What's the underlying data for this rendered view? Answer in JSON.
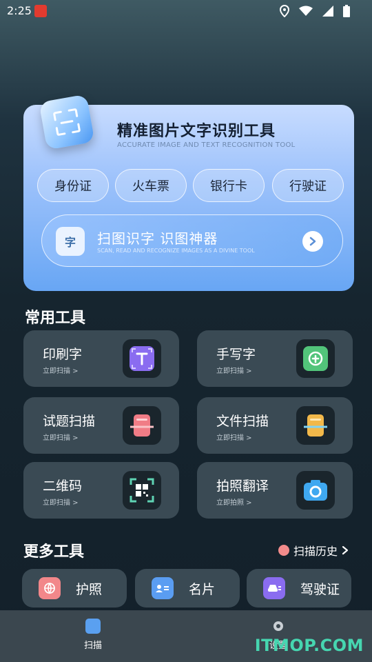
{
  "status_bar": {
    "time": "2:25"
  },
  "hero": {
    "title": "精准图片文字识别工具",
    "subtitle": "ACCURATE IMAGE AND TEXT RECOGNITION TOOL",
    "doc_types": [
      "身份证",
      "火车票",
      "银行卡",
      "行驶证"
    ],
    "scan": {
      "icon_text": "字",
      "title": "扫图识字  识图神器",
      "subtitle": "SCAN, READ AND RECOGNIZE IMAGES AS A DIVINE TOOL"
    }
  },
  "common_tools": {
    "title": "常用工具",
    "items": [
      {
        "name": "印刷字",
        "action": "立即扫描 >",
        "icon": "print-text-icon",
        "color": "#8a6cf0"
      },
      {
        "name": "手写字",
        "action": "立即扫描 >",
        "icon": "handwriting-icon",
        "color": "#52c47a"
      },
      {
        "name": "试题扫描",
        "action": "立即扫描 >",
        "icon": "exam-scan-icon",
        "color": "#f07c86"
      },
      {
        "name": "文件扫描",
        "action": "立即扫描 >",
        "icon": "document-scan-icon",
        "color": "#f2b84a"
      },
      {
        "name": "二维码",
        "action": "立即扫描 >",
        "icon": "qr-code-icon",
        "color": "#5fd3b3"
      },
      {
        "name": "拍照翻译",
        "action": "立即拍照 >",
        "icon": "camera-icon",
        "color": "#3fa8f0"
      }
    ]
  },
  "more_tools": {
    "title": "更多工具",
    "history_label": "扫描历史",
    "items": [
      {
        "label": "护照",
        "icon": "passport-icon",
        "color": "#f2878a"
      },
      {
        "label": "名片",
        "icon": "business-card-icon",
        "color": "#5a9df2"
      },
      {
        "label": "驾驶证",
        "icon": "driver-license-icon",
        "color": "#8a6cf0"
      }
    ]
  },
  "bottom_nav": {
    "scan_label": "扫描",
    "settings_label": "设置"
  },
  "watermark": "ITMOP.COM"
}
